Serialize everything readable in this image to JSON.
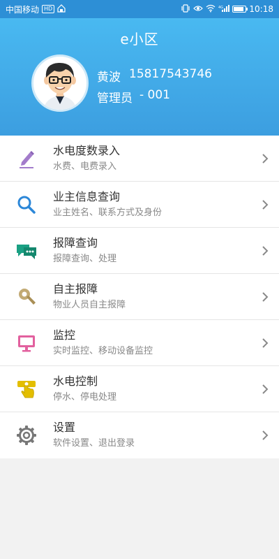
{
  "status_bar": {
    "carrier": "中国移动",
    "hd_badge": "HD",
    "time": "10:18",
    "network": "4G",
    "battery_level": 0.85
  },
  "header": {
    "title": "e小区",
    "user_name": "黄波",
    "phone": "15817543746",
    "role": "管理员",
    "role_id": "- 001"
  },
  "menu": {
    "items": [
      {
        "title": "水电度数录入",
        "subtitle": "水费、电费录入",
        "icon": "pencil-icon",
        "color": "#9b6fc4"
      },
      {
        "title": "业主信息查询",
        "subtitle": "业主姓名、联系方式及身份",
        "icon": "search-icon",
        "color": "#2c87d8"
      },
      {
        "title": "报障查询",
        "subtitle": "报障查询、处理",
        "icon": "chat-icon",
        "color": "#1aa083"
      },
      {
        "title": "自主报障",
        "subtitle": "物业人员自主报障",
        "icon": "wrench-icon",
        "color": "#b9a06a"
      },
      {
        "title": "监控",
        "subtitle": "实时监控、移动设备监控",
        "icon": "monitor-icon",
        "color": "#e2609e"
      },
      {
        "title": "水电控制",
        "subtitle": "停水、停电处理",
        "icon": "hand-switch-icon",
        "color": "#e3be00"
      },
      {
        "title": "设置",
        "subtitle": "软件设置、退出登录",
        "icon": "gear-icon",
        "color": "#777777"
      }
    ]
  }
}
